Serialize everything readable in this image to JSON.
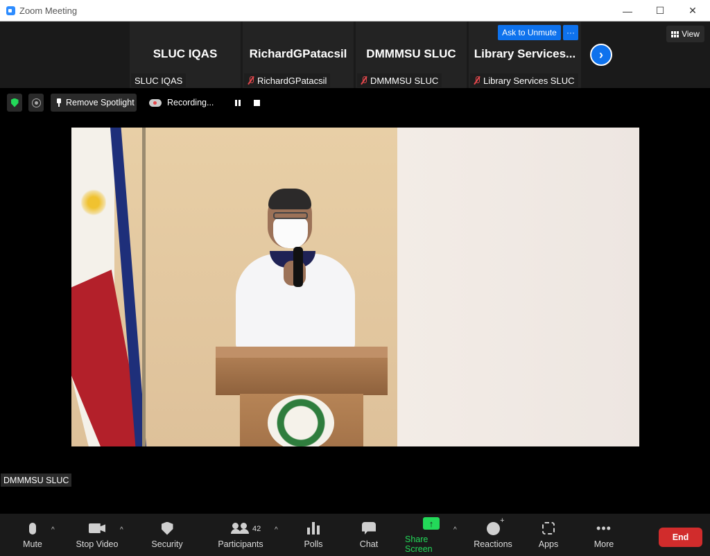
{
  "window": {
    "title": "Zoom Meeting",
    "minimize": "—",
    "maximize": "☐",
    "close": "✕"
  },
  "gallery": {
    "tiles": [
      {
        "name": "SLUC IQAS",
        "label": "SLUC IQAS",
        "muted": false
      },
      {
        "name": "RichardGPatacsil",
        "label": "RichardGPatacsil",
        "muted": true
      },
      {
        "name": "DMMMSU SLUC",
        "label": "DMMMSU SLUC",
        "muted": true
      },
      {
        "name": "Library  Services...",
        "label": "Library Services SLUC",
        "muted": true
      }
    ],
    "ask_to_unmute": "Ask to Unmute",
    "more": "···",
    "next_page": "›",
    "view_label": "View"
  },
  "meeting_bar": {
    "remove_spotlight": "Remove Spotlight",
    "recording": "Recording..."
  },
  "main_video": {
    "speaker_label": "DMMMSU SLUC"
  },
  "toolbar": {
    "mute": "Mute",
    "stop_video": "Stop Video",
    "security": "Security",
    "participants": "Participants",
    "participants_count": "42",
    "polls": "Polls",
    "chat": "Chat",
    "share_screen": "Share Screen",
    "reactions": "Reactions",
    "apps": "Apps",
    "more": "More",
    "end": "End",
    "caret": "^",
    "share_arrow": "↑",
    "more_dots": "•••"
  },
  "colors": {
    "accent_blue": "#0e72ed",
    "share_green": "#23d959",
    "end_red": "#d12c2c",
    "muted_red": "#e5484d"
  }
}
